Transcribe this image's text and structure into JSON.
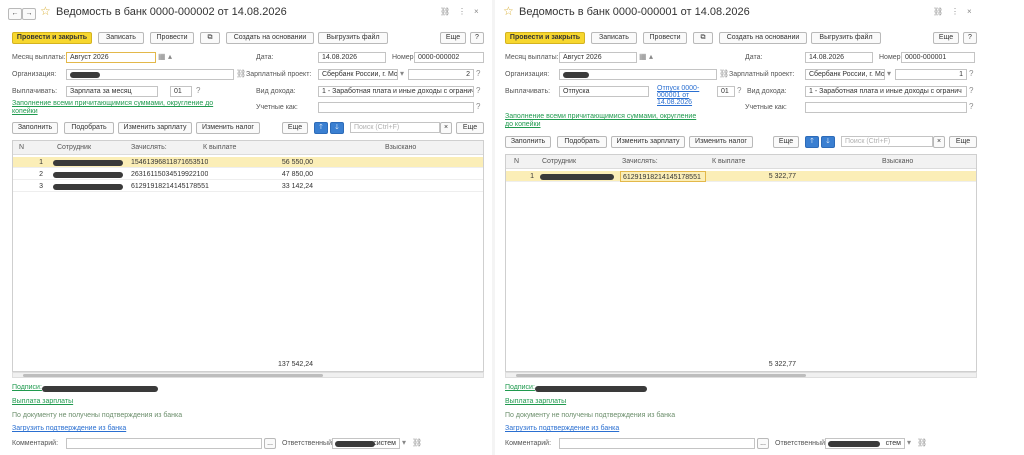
{
  "left": {
    "title": "Ведомость в банк 0000-000002 от 14.08.2026",
    "toolbar": {
      "post_close": "Провести и закрыть",
      "save": "Записать",
      "post": "Провести",
      "create_based": "Создать на основании",
      "upload": "Выгрузить файл",
      "more": "Еще",
      "help": "?"
    },
    "form": {
      "month_label": "Месяц выплаты:",
      "month_value": "Август 2026",
      "date_label": "Дата:",
      "date_value": "14.08.2026",
      "number_label": "Номер:",
      "number_value": "0000-000002",
      "org_label": "Организация:",
      "project_label": "Зарплатный проект:",
      "project_value": "Сбербанк России, г. Моск",
      "project_count": "2",
      "pay_label": "Выплачивать:",
      "pay_value": "Зарплата за месяц",
      "pay_code": "01",
      "income_label": "Вид дохода:",
      "income_value": "1 - Заработная плата и иные доходы с огранич",
      "fill_link": "Заполнение всеми причитающимися суммами, округление до копейки",
      "account_label": "Учетные как:"
    },
    "tablebar": {
      "fill": "Заполнить",
      "pick": "Подобрать",
      "change_salary": "Изменить зарплату",
      "change_tax": "Изменить налог",
      "more": "Еще",
      "search_ph": "Поиск (Ctrl+F)",
      "more2": "Еще"
    },
    "table": {
      "headers": {
        "n": "N",
        "employee": "Сотрудник",
        "account": "Зачислять:",
        "amount": "К выплате",
        "collected": "Взыскано"
      },
      "rows": [
        {
          "n": "1",
          "account": "15461396811871653510",
          "amount": "56 550,00"
        },
        {
          "n": "2",
          "account": "26316115034519922100",
          "amount": "47 850,00"
        },
        {
          "n": "3",
          "account": "61291918214145178551",
          "amount": "33 142,24"
        }
      ],
      "total": "137 542,24"
    },
    "footer": {
      "signatures": "Подписи:",
      "salary_pay": "Выплата зарплаты",
      "no_confirm": "По документу не получены подтверждения из банка",
      "load_confirm": "Загрузить подтверждение из банка",
      "comment_label": "Комментарий:",
      "responsible_label": "Ответственный:",
      "responsible_tail": "систем"
    }
  },
  "right": {
    "title": "Ведомость в банк 0000-000001 от 14.08.2026",
    "toolbar": {
      "post_close": "Провести и закрыть",
      "save": "Записать",
      "post": "Провести",
      "create_based": "Создать на основании",
      "upload": "Выгрузить файл",
      "more": "Еще",
      "help": "?"
    },
    "form": {
      "month_label": "Месяц выплаты:",
      "month_value": "Август 2026",
      "date_label": "Дата:",
      "date_value": "14.08.2026",
      "number_label": "Номер:",
      "number_value": "0000-000001",
      "org_label": "Организация:",
      "project_label": "Зарплатный проект:",
      "project_value": "Сбербанк России, г. Моск",
      "project_count": "1",
      "pay_label": "Выплачивать:",
      "pay_value": "Отпуска",
      "pay_doc_link": "Отпуск 0000-000001 от 14.08.2026",
      "pay_code": "01",
      "income_label": "Вид дохода:",
      "income_value": "1 - Заработная плата и иные доходы с огранич",
      "fill_link": "Заполнение всеми причитающимися суммами, округление до копейки",
      "account_label": "Учетные как:"
    },
    "tablebar": {
      "fill": "Заполнить",
      "pick": "Подобрать",
      "change_salary": "Изменить зарплату",
      "change_tax": "Изменить налог",
      "more": "Еще",
      "search_ph": "Поиск (Ctrl+F)",
      "more2": "Еще"
    },
    "table": {
      "headers": {
        "n": "N",
        "employee": "Сотрудник",
        "account": "Зачислять:",
        "amount": "К выплате",
        "collected": "Взыскано"
      },
      "rows": [
        {
          "n": "1",
          "account": "61291918214145178551",
          "amount": "5 322,77"
        }
      ],
      "total": "5 322,77"
    },
    "footer": {
      "signatures": "Подписи:",
      "salary_pay": "Выплата зарплаты",
      "no_confirm": "По документу не получены подтверждения из банка",
      "load_confirm": "Загрузить подтверждение из банка",
      "comment_label": "Комментарий:",
      "responsible_label": "Ответственный:",
      "responsible_tail": "стем"
    }
  },
  "icons": {
    "back": "←",
    "forward": "→",
    "star": "☆",
    "link": "⛓",
    "menu": "⋮",
    "close": "×",
    "calendar": "▦",
    "dropdown": "▾",
    "up": "▴",
    "clip": "⧉",
    "arrow_up": "🡑",
    "arrow_down": "🡓",
    "clear": "×",
    "ellipsis": "...",
    "help": "?"
  },
  "colors": {
    "primary": "#f7d72e",
    "selected_row": "#fbeeb7",
    "link": "#2a6fd1",
    "green_link": "#1f9a4e"
  }
}
